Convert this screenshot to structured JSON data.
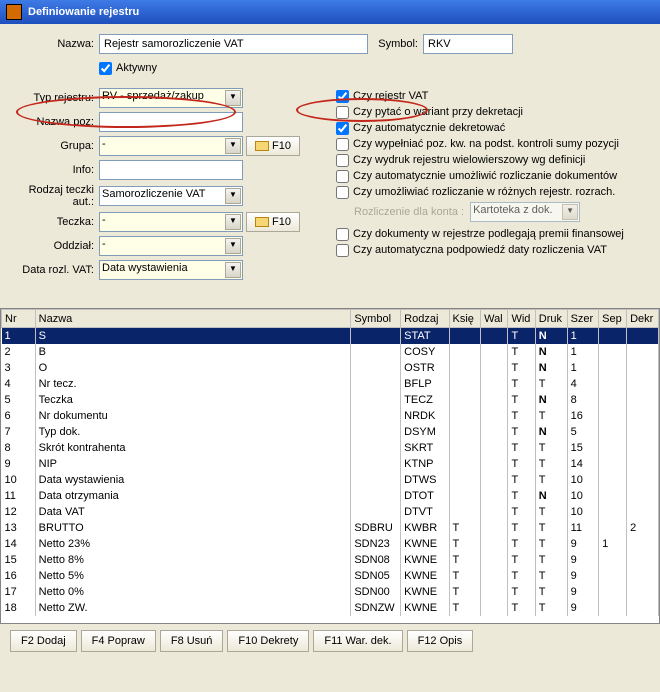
{
  "window": {
    "title": "Definiowanie rejestru"
  },
  "labels": {
    "nazwa": "Nazwa:",
    "symbol": "Symbol:",
    "aktywny": "Aktywny",
    "typRejestru": "Typ rejestru:",
    "nazwaPoz": "Nazwa poz:",
    "grupa": "Grupa:",
    "info": "Info:",
    "rodzajTeczki": "Rodzaj teczki aut.:",
    "teczka": "Teczka:",
    "oddzial": "Oddział:",
    "dataRozlVat": "Data rozl. VAT:",
    "rozliczenieDla": "Rozliczenie dla konta :",
    "f10": "F10"
  },
  "fields": {
    "nazwa": "Rejestr samorozliczenie VAT",
    "symbol": "RKV",
    "aktywny": true,
    "typRejestru": "RV - sprzedaż/zakup",
    "nazwaPoz": "",
    "grupa": "-",
    "info": "",
    "rodzajTeczki": "Samorozliczenie VAT",
    "teczka": "-",
    "oddzial": "-",
    "dataRozlVat": "Data wystawienia",
    "rozliczenieKonto": "Kartoteka z dok."
  },
  "rightChecks": [
    {
      "label": "Czy rejestr VAT",
      "checked": true
    },
    {
      "label": "Czy pytać o wariant przy dekretacji",
      "checked": false
    },
    {
      "label": "Czy automatycznie dekretować",
      "checked": true
    },
    {
      "label": "Czy wypełniać poz. kw. na podst. kontroli sumy pozycji",
      "checked": false
    },
    {
      "label": "Czy wydruk rejestru wielowierszowy wg definicji",
      "checked": false
    },
    {
      "label": "Czy automatycznie umożliwić rozliczanie dokumentów",
      "checked": false
    },
    {
      "label": "Czy umożliwiać rozliczanie w różnych rejestr. rozrach.",
      "checked": false
    }
  ],
  "rightChecksBottom": [
    {
      "label": "Czy dokumenty w rejestrze podlegają premii finansowej",
      "checked": false
    },
    {
      "label": "Czy automatyczna podpowiedź daty rozliczenia VAT",
      "checked": false
    }
  ],
  "grid": {
    "headers": [
      "Nr",
      "Nazwa",
      "Symbol",
      "Rodzaj",
      "Księ",
      "Wal",
      "Wid",
      "Druk",
      "Szer",
      "Sep",
      "Dekr"
    ],
    "rows": [
      {
        "nr": "1",
        "nazwa": "S",
        "symbol": "",
        "rodzaj": "STAT",
        "ksie": "",
        "wal": "",
        "wid": "T",
        "druk": "N",
        "szer": "1",
        "sep": "",
        "dekr": "",
        "drukBold": true,
        "selected": true
      },
      {
        "nr": "2",
        "nazwa": "B",
        "symbol": "",
        "rodzaj": "COSY",
        "ksie": "",
        "wal": "",
        "wid": "T",
        "druk": "N",
        "szer": "1",
        "sep": "",
        "dekr": "",
        "drukBold": true
      },
      {
        "nr": "3",
        "nazwa": "O",
        "symbol": "",
        "rodzaj": "OSTR",
        "ksie": "",
        "wal": "",
        "wid": "T",
        "druk": "N",
        "szer": "1",
        "sep": "",
        "dekr": "",
        "drukBold": true
      },
      {
        "nr": "4",
        "nazwa": "Nr tecz.",
        "symbol": "",
        "rodzaj": "BFLP",
        "ksie": "",
        "wal": "",
        "wid": "T",
        "druk": "T",
        "szer": "4",
        "sep": "",
        "dekr": ""
      },
      {
        "nr": "5",
        "nazwa": "Teczka",
        "symbol": "",
        "rodzaj": "TECZ",
        "ksie": "",
        "wal": "",
        "wid": "T",
        "druk": "N",
        "szer": "8",
        "sep": "",
        "dekr": "",
        "drukBold": true
      },
      {
        "nr": "6",
        "nazwa": "Nr dokumentu",
        "symbol": "",
        "rodzaj": "NRDK",
        "ksie": "",
        "wal": "",
        "wid": "T",
        "druk": "T",
        "szer": "16",
        "sep": "",
        "dekr": ""
      },
      {
        "nr": "7",
        "nazwa": "Typ dok.",
        "symbol": "",
        "rodzaj": "DSYM",
        "ksie": "",
        "wal": "",
        "wid": "T",
        "druk": "N",
        "szer": "5",
        "sep": "",
        "dekr": "",
        "drukBold": true
      },
      {
        "nr": "8",
        "nazwa": "Skrót kontrahenta",
        "symbol": "",
        "rodzaj": "SKRT",
        "ksie": "",
        "wal": "",
        "wid": "T",
        "druk": "T",
        "szer": "15",
        "sep": "",
        "dekr": ""
      },
      {
        "nr": "9",
        "nazwa": "NIP",
        "symbol": "",
        "rodzaj": "KTNP",
        "ksie": "",
        "wal": "",
        "wid": "T",
        "druk": "T",
        "szer": "14",
        "sep": "",
        "dekr": ""
      },
      {
        "nr": "10",
        "nazwa": "Data wystawienia",
        "symbol": "",
        "rodzaj": "DTWS",
        "ksie": "",
        "wal": "",
        "wid": "T",
        "druk": "T",
        "szer": "10",
        "sep": "",
        "dekr": ""
      },
      {
        "nr": "11",
        "nazwa": "Data otrzymania",
        "symbol": "",
        "rodzaj": "DTOT",
        "ksie": "",
        "wal": "",
        "wid": "T",
        "druk": "N",
        "szer": "10",
        "sep": "",
        "dekr": "",
        "drukBold": true
      },
      {
        "nr": "12",
        "nazwa": "Data VAT",
        "symbol": "",
        "rodzaj": "DTVT",
        "ksie": "",
        "wal": "",
        "wid": "T",
        "druk": "T",
        "szer": "10",
        "sep": "",
        "dekr": ""
      },
      {
        "nr": "13",
        "nazwa": "BRUTTO",
        "symbol": "SDBRU",
        "rodzaj": "KWBR",
        "ksie": "T",
        "wal": "",
        "wid": "T",
        "druk": "T",
        "szer": "11",
        "sep": "",
        "dekr": "2"
      },
      {
        "nr": "14",
        "nazwa": "Netto 23%",
        "symbol": "SDN23",
        "rodzaj": "KWNE",
        "ksie": "T",
        "wal": "",
        "wid": "T",
        "druk": "T",
        "szer": "9",
        "sep": "1",
        "dekr": ""
      },
      {
        "nr": "15",
        "nazwa": "Netto 8%",
        "symbol": "SDN08",
        "rodzaj": "KWNE",
        "ksie": "T",
        "wal": "",
        "wid": "T",
        "druk": "T",
        "szer": "9",
        "sep": "",
        "dekr": ""
      },
      {
        "nr": "16",
        "nazwa": "Netto 5%",
        "symbol": "SDN05",
        "rodzaj": "KWNE",
        "ksie": "T",
        "wal": "",
        "wid": "T",
        "druk": "T",
        "szer": "9",
        "sep": "",
        "dekr": ""
      },
      {
        "nr": "17",
        "nazwa": "Netto 0%",
        "symbol": "SDN00",
        "rodzaj": "KWNE",
        "ksie": "T",
        "wal": "",
        "wid": "T",
        "druk": "T",
        "szer": "9",
        "sep": "",
        "dekr": ""
      },
      {
        "nr": "18",
        "nazwa": "Netto ZW.",
        "symbol": "SDNZW",
        "rodzaj": "KWNE",
        "ksie": "T",
        "wal": "",
        "wid": "T",
        "druk": "T",
        "szer": "9",
        "sep": "",
        "dekr": ""
      }
    ]
  },
  "buttons": {
    "f2": "F2 Dodaj",
    "f4": "F4 Popraw",
    "f8": "F8 Usuń",
    "f10": "F10 Dekrety",
    "f11": "F11 War. dek.",
    "f12": "F12 Opis"
  }
}
